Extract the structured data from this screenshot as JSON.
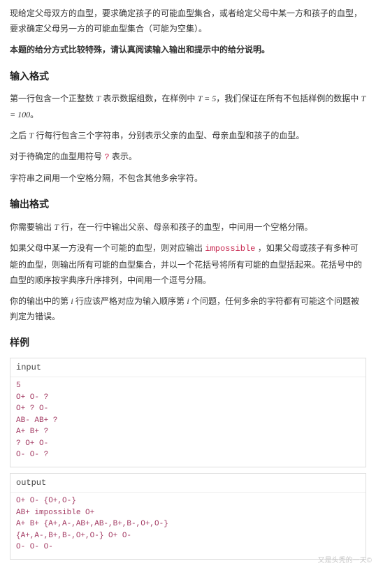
{
  "intro": {
    "p1": "现给定父母双方的血型，要求确定孩子的可能血型集合，或者给定父母中某一方和孩子的血型，要求确定父母另一方的可能血型集合（可能为空集）。",
    "p2": "本题的给分方式比较特殊，请认真阅读输入输出和提示中的给分说明。"
  },
  "input_format": {
    "heading": "输入格式",
    "p1a": "第一行包含一个正整数 ",
    "p1var1": "T",
    "p1b": " 表示数据组数，在样例中 ",
    "p1eq1": "T = 5",
    "p1c": "，我们保证在所有不包括样例的数据中 ",
    "p1eq2": "T = 100",
    "p1d": "。",
    "p2a": "之后 ",
    "p2var": "T",
    "p2b": " 行每行包含三个字符串，分别表示父亲的血型、母亲血型和孩子的血型。",
    "p3a": "对于待确定的血型用符号 ",
    "p3q": "?",
    "p3b": " 表示。",
    "p4": "字符串之间用一个空格分隔，不包含其他多余字符。"
  },
  "output_format": {
    "heading": "输出格式",
    "p1a": "你需要输出 ",
    "p1var": "T",
    "p1b": " 行，在一行中输出父亲、母亲和孩子的血型，中间用一个空格分隔。",
    "p2a": "如果父母中某一方没有一个可能的血型，则对应输出 ",
    "p2imp": "impossible",
    "p2b": " ，如果父母或孩子有多种可能的血型，则输出所有可能的血型集合，并以一个花括号将所有可能的血型括起来。花括号中的血型的顺序按字典序升序排列，中间用一个逗号分隔。",
    "p3a": "你的输出中的第 ",
    "p3var": "i",
    "p3b": " 行应该严格对应为输入顺序第 ",
    "p3var2": "i",
    "p3c": " 个问题，任何多余的字符都有可能这个问题被判定为错误。"
  },
  "sample": {
    "heading": "样例",
    "input_label": "input",
    "input_text": "5\nO+ O- ?\nO+ ? O-\nAB- AB+ ?\nA+ B+ ?\n? O+ O-\nO- O- ?",
    "output_label": "output",
    "output_text": "O+ O- {O+,O-}\nAB+ impossible O+\nA+ B+ {A+,A-,AB+,AB-,B+,B-,O+,O-}\n{A+,A-,B+,B-,O+,O-} O+ O-\nO- O- O-"
  },
  "watermark": "又是头秃的一天©"
}
